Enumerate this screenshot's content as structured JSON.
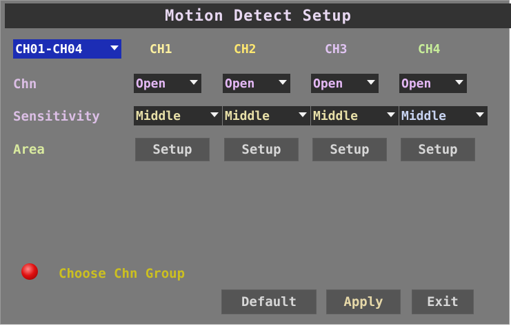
{
  "title": "Motion Detect Setup",
  "group_select": {
    "value": "CH01-CH04"
  },
  "channels": [
    {
      "label": "CH1",
      "color": "#fff2a0",
      "chn": "Open",
      "sensitivity": "Middle",
      "area": "Setup"
    },
    {
      "label": "CH2",
      "color": "#ffe870",
      "chn": "Open",
      "sensitivity": "Middle",
      "area": "Setup"
    },
    {
      "label": "CH3",
      "color": "#e0c4f2",
      "chn": "Open",
      "sensitivity": "Middle",
      "area": "Setup"
    },
    {
      "label": "CH4",
      "color": "#c8ee9a",
      "chn": "Open",
      "sensitivity": "Middle",
      "area": "Setup"
    }
  ],
  "row_labels": {
    "chn": "Chn",
    "sensitivity": "Sensitivity",
    "area": "Area"
  },
  "value_colors": {
    "chn": "#e4b8f5",
    "sensitivity": "#e8e0a8"
  },
  "status": {
    "text": "Choose Chn Group",
    "indicator_color": "#e01010"
  },
  "buttons": {
    "default": "Default",
    "apply": "Apply",
    "exit": "Exit"
  }
}
